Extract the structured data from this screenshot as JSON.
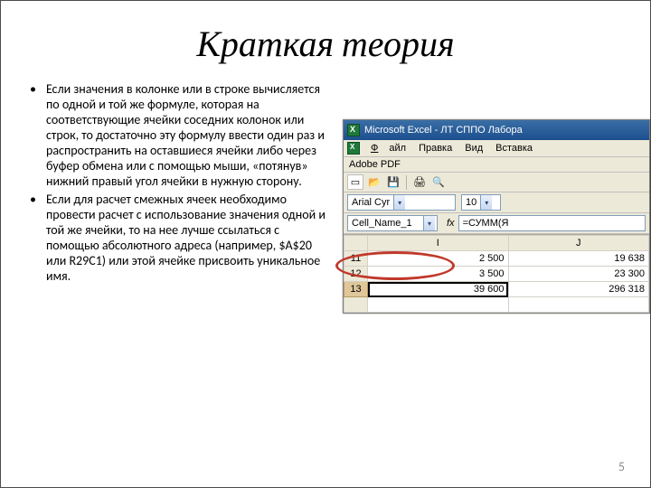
{
  "slide": {
    "title": "Краткая теория",
    "page_number": "5"
  },
  "bullets": [
    "Если значения в колонке или в строке вычисляется по одной и той же формуле, которая на соответствующие ячейки соседних колонок или строк, то достаточно эту формулу ввести один раз и распространить на оставшиеся ячейки либо через буфер обмена или с помощью мыши, «потянув» нижний правый угол ячейки в нужную сторону.",
    "Если для расчет смежных ячеек необходимо провести расчет с использование значения одной и той же ячейки, то на нее лучше ссылаться с помощью абсолютного адреса (например, $A$20 или R29C1) или этой ячейке присвоить уникальное имя."
  ],
  "excel": {
    "app_title": "Microsoft Excel - ЛТ СППО Лабора",
    "menu": {
      "file": "Файл",
      "edit": "Правка",
      "view": "Вид",
      "insert": "Вставка"
    },
    "pdf_toolbar": "Adobe PDF",
    "font_name": "Arial Cyr",
    "font_size": "10",
    "name_box": "Cell_Name_1",
    "fx_label": "fx",
    "formula": "=СУММ(Я",
    "columns": [
      "I",
      "J"
    ],
    "rows": [
      {
        "num": "11",
        "i": "2 500",
        "j": "19 638"
      },
      {
        "num": "12",
        "i": "3 500",
        "j": "23 300"
      },
      {
        "num": "13",
        "i": "39 600",
        "j": "296 318",
        "selected": true
      }
    ]
  }
}
